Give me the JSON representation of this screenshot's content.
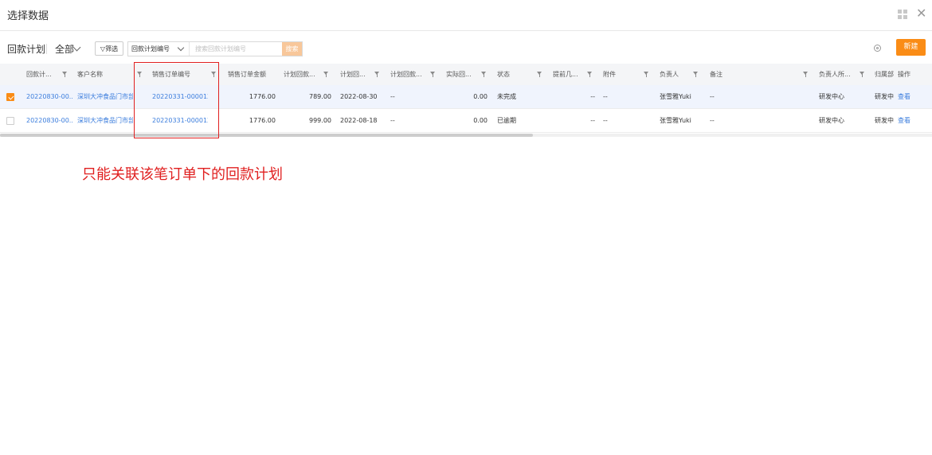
{
  "dialog": {
    "title": "选择数据",
    "grid_icon": "grid-icon",
    "close_glyph": "✕"
  },
  "toolbar": {
    "title": "回款计划",
    "scope": "全部",
    "filter_label": "筛选",
    "search_field": "回款计划编号",
    "search_placeholder": "搜索回款计划编号",
    "search_button": "搜索",
    "new_button": "新建"
  },
  "columns": [
    {
      "label": "回款计...",
      "filter": true
    },
    {
      "label": "客户名称",
      "filter": true
    },
    {
      "label": "销售订单编号",
      "filter": true
    },
    {
      "label": "销售订单金额",
      "filter": false
    },
    {
      "label": "计划回款...",
      "filter": true
    },
    {
      "label": "计划回...",
      "filter": true
    },
    {
      "label": "计划回款...",
      "filter": true
    },
    {
      "label": "实际回...",
      "filter": true
    },
    {
      "label": "状态",
      "filter": true
    },
    {
      "label": "提前几...",
      "filter": true
    },
    {
      "label": "附件",
      "filter": true
    },
    {
      "label": "负责人",
      "filter": true
    },
    {
      "label": "备注",
      "filter": true
    },
    {
      "label": "负责人所...",
      "filter": true
    },
    {
      "label": "归属部",
      "filter": false
    },
    {
      "label": "操作",
      "filter": false
    }
  ],
  "rows": [
    {
      "selected": true,
      "plan_no": "20220830-00...",
      "customer": "深圳大冲食品门市部",
      "order_no": "20220331-000012",
      "order_amount": "1776.00",
      "plan_amount": "789.00",
      "plan_date": "2022-08-30",
      "plan_other": "--",
      "actual": "0.00",
      "status": "未完成",
      "advance": "--",
      "attachment": "--",
      "owner": "张雪雅Yuki",
      "remark": "--",
      "owner_dept": "研发中心",
      "dept": "研发中",
      "action": "查看"
    },
    {
      "selected": false,
      "plan_no": "20220830-00...",
      "customer": "深圳大冲食品门市部",
      "order_no": "20220331-000012",
      "order_amount": "1776.00",
      "plan_amount": "999.00",
      "plan_date": "2022-08-18",
      "plan_other": "--",
      "actual": "0.00",
      "status": "已逾期",
      "advance": "--",
      "attachment": "--",
      "owner": "张雪雅Yuki",
      "remark": "--",
      "owner_dept": "研发中心",
      "dept": "研发中",
      "action": "查看"
    }
  ],
  "annotation": {
    "text": "只能关联该笔订单下的回款计划",
    "color": "#e02020"
  },
  "colors": {
    "accent": "#fa8c16",
    "link": "#3b7ddd",
    "selected_row": "#f0f4fd"
  }
}
